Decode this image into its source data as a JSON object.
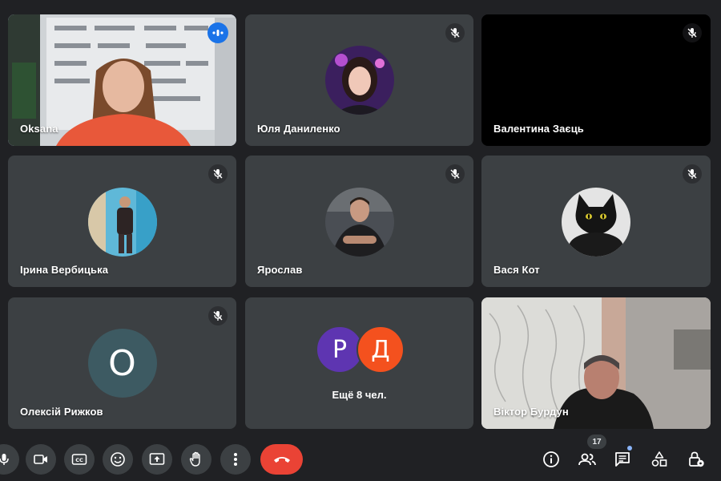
{
  "participants": [
    {
      "name": "Oksana",
      "state": "speaking"
    },
    {
      "name": "Юля Даниленко",
      "state": "muted"
    },
    {
      "name": "Валентина Заєць",
      "state": "muted"
    },
    {
      "name": "Ірина Вербицька",
      "state": "muted"
    },
    {
      "name": "Ярослав",
      "state": "muted"
    },
    {
      "name": "Вася Кот",
      "state": "muted"
    },
    {
      "name": "Олексій Рижков",
      "state": "muted",
      "initial": "О"
    },
    {
      "name": "Віктор Бурдун",
      "state": "video"
    }
  ],
  "more_tile": {
    "label": "Ещё 8 чел.",
    "initials": [
      "Р",
      "Д"
    ],
    "colors": [
      "#5e35b1",
      "#f4511e"
    ]
  },
  "toolbar": {
    "participant_count": "17",
    "buttons": [
      "mic-icon",
      "camera-icon",
      "captions-icon",
      "emoji-icon",
      "present-icon",
      "raise-hand-icon",
      "more-options-icon",
      "end-call-icon"
    ],
    "right_buttons": [
      "info-icon",
      "people-icon",
      "chat-icon",
      "activities-icon",
      "host-controls-icon"
    ]
  },
  "colors": {
    "background": "#202124",
    "tile": "#3c4043",
    "active_border": "#8ab4f8",
    "end_call": "#ea4335",
    "speaking_badge": "#1a73e8"
  }
}
